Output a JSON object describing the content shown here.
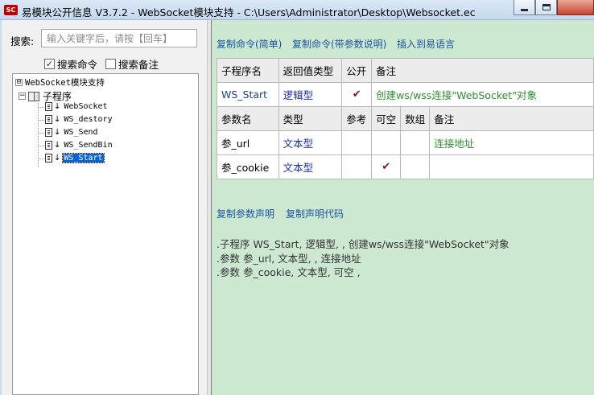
{
  "window": {
    "app_icon_text": "SC",
    "title": "易模块公开信息 V3.7.2 - WebSocket模块支持 - C:\\Users\\Administrator\\Desktop\\Websocket.ec"
  },
  "search": {
    "label": "搜索:",
    "placeholder": "输入关键字后，请按【回车】",
    "value": ""
  },
  "filters": {
    "search_commands": {
      "label": "搜索命令",
      "checked": true,
      "mark": "✓"
    },
    "search_notes": {
      "label": "搜索备注",
      "checked": false,
      "mark": ""
    }
  },
  "tree": {
    "root_expander": "⊟",
    "root_label": "WebSocket模块支持",
    "sub_expander": "−",
    "sub_label": "子程序",
    "arrow": "↓",
    "items": [
      {
        "label": "WebSocket"
      },
      {
        "label": "WS_destory"
      },
      {
        "label": "WS_Send"
      },
      {
        "label": "WS_SendBin"
      },
      {
        "label": "WS_Start",
        "selected": true
      }
    ]
  },
  "actions": {
    "copy_simple": "复制命令(简单)",
    "copy_with_params": "复制命令(带参数说明)",
    "insert_to_eyuyan": "插入到易语言",
    "copy_param_decl": "复制参数声明",
    "copy_decl_code": "复制声明代码"
  },
  "sub_table": {
    "headers": [
      "子程序名",
      "返回值类型",
      "公开",
      "备注"
    ],
    "row": {
      "name": "WS_Start",
      "return_type": "逻辑型",
      "public": "✔",
      "note": "创建ws/wss连接\"WebSocket\"对象"
    }
  },
  "param_table": {
    "headers": [
      "参数名",
      "类型",
      "参考",
      "可空",
      "数组",
      "备注"
    ],
    "rows": [
      {
        "name": "参_url",
        "type": "文本型",
        "ref": "",
        "nullable": "",
        "array": "",
        "note": "连接地址"
      },
      {
        "name": "参_cookie",
        "type": "文本型",
        "ref": "",
        "nullable": "✔",
        "array": "",
        "note": ""
      }
    ]
  },
  "declaration": {
    "lines": [
      ".子程序 WS_Start, 逻辑型, , 创建ws/wss连接\"WebSocket\"对象",
      ".参数 参_url, 文本型, , 连接地址",
      ".参数 参_cookie, 文本型, 可空 ,"
    ]
  }
}
